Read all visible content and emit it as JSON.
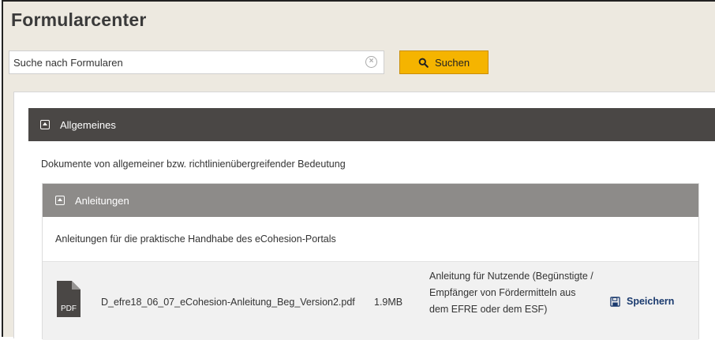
{
  "page": {
    "title": "Formularcenter"
  },
  "search": {
    "value": "Suche nach Formularen",
    "clear_icon": "clear-icon",
    "button_label": "Suchen",
    "button_icon": "search-icon",
    "accent": "#f5b400"
  },
  "section_main": {
    "title": "Allgemeines",
    "icon": "collapse-icon",
    "description": "Dokumente von allgemeiner bzw. richtlinienübergreifender Bedeutung",
    "color": "#4a4745"
  },
  "section_sub": {
    "title": "Anleitungen",
    "icon": "collapse-icon",
    "description": "Anleitungen für die praktische Handhabe des eCohesion-Portals",
    "color": "#8d8b89"
  },
  "files": [
    {
      "icon_label": "PDF",
      "name": "D_efre18_06_07_eCohesion-Anleitung_Beg_Version2.pdf",
      "size": "1.9MB",
      "description": "Anleitung für Nutzende (Begünstigte / Empfänger von Fördermitteln aus dem EFRE oder dem ESF)",
      "save_label": "Speichern",
      "save_icon": "save-icon"
    }
  ]
}
